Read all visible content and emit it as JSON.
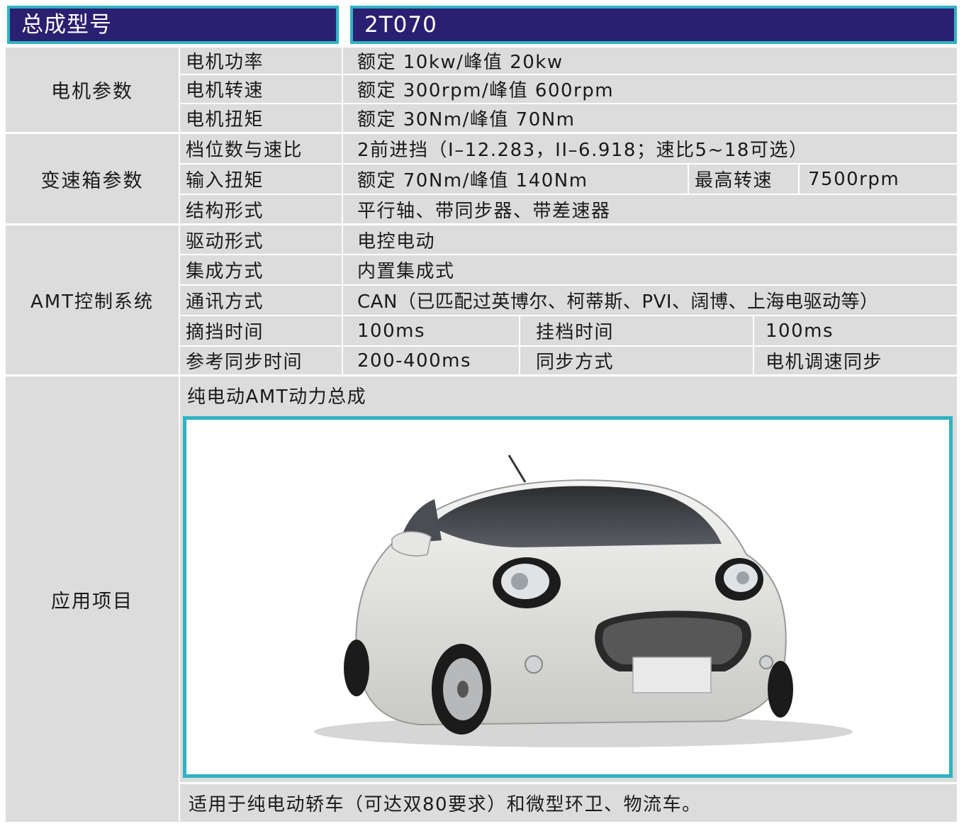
{
  "header": {
    "label": "总成型号",
    "model": "2T070"
  },
  "motor": {
    "group": "电机参数",
    "power_label": "电机功率",
    "power_value": "额定 10kw/峰值 20kw",
    "speed_label": "电机转速",
    "speed_value": "额定 300rpm/峰值 600rpm",
    "torque_label": "电机扭矩",
    "torque_value": "额定 30Nm/峰值 70Nm"
  },
  "gearbox": {
    "group": "变速箱参数",
    "gears_label": "档位数与速比",
    "gears_value": "2前进挡（I–12.283，II–6.918；速比5~18可选）",
    "input_torque_label": "输入扭矩",
    "input_torque_value": "额定 70Nm/峰值 140Nm",
    "max_speed_label": "最高转速",
    "max_speed_value": "7500rpm",
    "structure_label": "结构形式",
    "structure_value": "平行轴、带同步器、带差速器"
  },
  "amt": {
    "group": "AMT控制系统",
    "drive_label": "驱动形式",
    "drive_value": "电控电动",
    "integration_label": "集成方式",
    "integration_value": "内置集成式",
    "comm_label": "通讯方式",
    "comm_value": "CAN（已匹配过英博尔、柯蒂斯、PVI、阔博、上海电驱动等）",
    "disengage_label": "摘挡时间",
    "disengage_value": "100ms",
    "engage_label": "挂档时间",
    "engage_value": "100ms",
    "sync_time_label": "参考同步时间",
    "sync_time_value": "200-400ms",
    "sync_mode_label": "同步方式",
    "sync_mode_value": "电机调速同步"
  },
  "application": {
    "group": "应用项目",
    "title": "纯电动AMT动力总成",
    "note": "适用于纯电动轿车（可达双80要求）和微型环卫、物流车。"
  },
  "colors": {
    "header_bg": "#2a1f70",
    "accent_border": "#2fb3c3",
    "cell_bg": "#dcdcdc"
  }
}
